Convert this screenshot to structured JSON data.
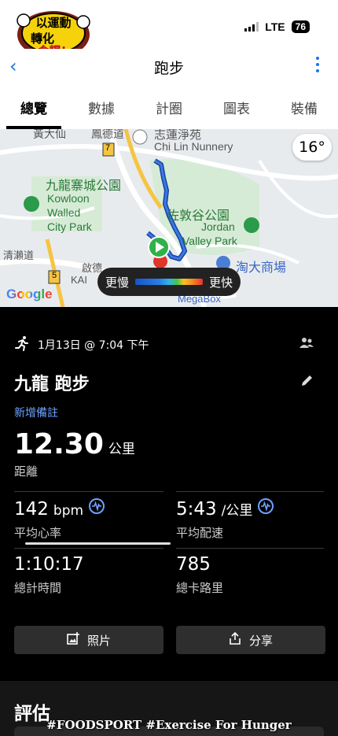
{
  "status": {
    "network": "LTE",
    "battery": "76"
  },
  "logo": {
    "line1": "以運動",
    "line2": "轉化",
    "line3": "食糧!"
  },
  "nav": {
    "title": "跑步"
  },
  "tabs": [
    {
      "label": "總覽",
      "active": true
    },
    {
      "label": "數據",
      "active": false
    },
    {
      "label": "計圈",
      "active": false
    },
    {
      "label": "圖表",
      "active": false
    },
    {
      "label": "裝備",
      "active": false
    }
  ],
  "map": {
    "temperature": "16°",
    "labels": {
      "top_left": "黃大仙",
      "top_mid": "鳳德道",
      "nunnery_zh": "志蓮淨苑",
      "nunnery_en": "Chi Lin Nunnery",
      "park_zh": "九龍寨城公園",
      "park_en1": "Kowloon",
      "park_en2": "Walled",
      "park_en3": "City Park",
      "jordan_zh": "佐敦谷公園",
      "jordan_en1": "Jordan",
      "jordan_en2": "Valley Park",
      "tao_zh": "淘大商場",
      "road_left": "清瀨道",
      "road_mid": "啟德",
      "kai": "KAI",
      "megabox": "MegaBox",
      "route7": "7",
      "route5": "5"
    },
    "speed_slow": "更慢",
    "speed_fast": "更快",
    "google": "Google"
  },
  "activity": {
    "datetime": "1月13日 @ 7:04 下午",
    "title": "九龍 跑步",
    "add_note": "新增備註",
    "distance_value": "12.30",
    "distance_unit": "公里",
    "distance_label": "距離",
    "hr_value": "142",
    "hr_unit": "bpm",
    "hr_label": "平均心率",
    "pace_value": "5:43",
    "pace_unit": "/公里",
    "pace_label": "平均配速",
    "time_value": "1:10:17",
    "time_label": "總計時間",
    "cal_value": "785",
    "cal_label": "總卡路里"
  },
  "buttons": {
    "photos": "照片",
    "share": "分享"
  },
  "section": {
    "title": "評估"
  },
  "watermark": "#FOODSPORT #Exercise For Hunger"
}
